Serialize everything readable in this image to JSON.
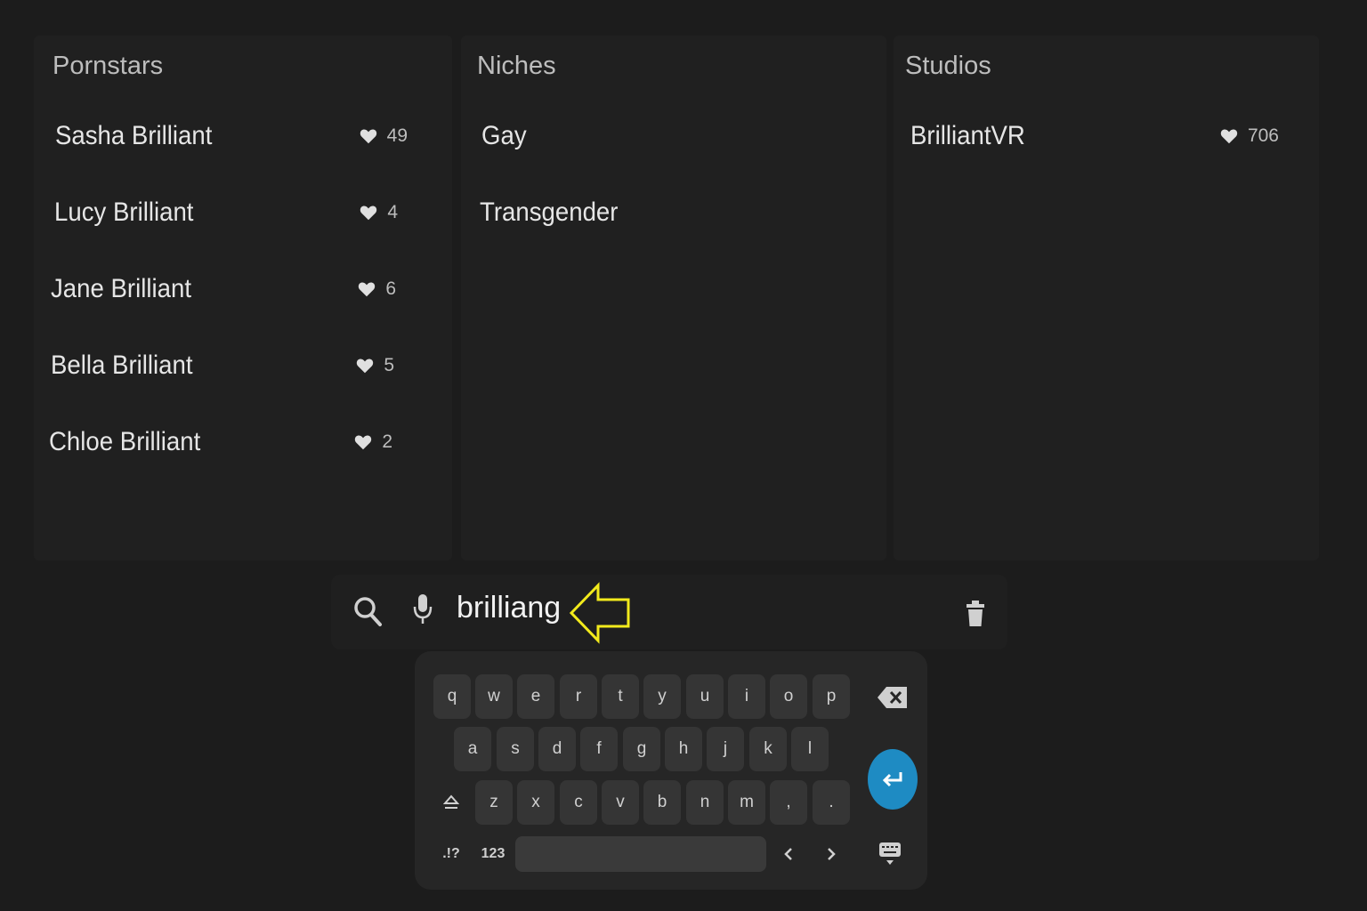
{
  "pornstars": {
    "title": "Pornstars",
    "items": [
      {
        "name": "Sasha Brilliant",
        "likes": "49"
      },
      {
        "name": "Lucy Brilliant",
        "likes": "4"
      },
      {
        "name": "Jane Brilliant",
        "likes": "6"
      },
      {
        "name": "Bella Brilliant",
        "likes": "5"
      },
      {
        "name": "Chloe Brilliant",
        "likes": "2"
      }
    ]
  },
  "niches": {
    "title": "Niches",
    "items": [
      {
        "name": "Gay"
      },
      {
        "name": "Transgender"
      }
    ]
  },
  "studios": {
    "title": "Studios",
    "items": [
      {
        "name": "BrilliantVR",
        "likes": "706"
      }
    ]
  },
  "search": {
    "value": "brilliang"
  },
  "keyboard": {
    "row1": [
      "q",
      "w",
      "e",
      "r",
      "t",
      "y",
      "u",
      "i",
      "o",
      "p"
    ],
    "row2": [
      "a",
      "s",
      "d",
      "f",
      "g",
      "h",
      "j",
      "k",
      "l"
    ],
    "row3": [
      "z",
      "x",
      "c",
      "v",
      "b",
      "n",
      "m",
      ",",
      "."
    ],
    "symbols_label": ".!?",
    "numbers_label": "123"
  },
  "colors": {
    "background": "#1c1c1c",
    "panel": "#202020",
    "enter_key": "#1e8bc3",
    "annotation_arrow": "#f2ea1c"
  }
}
